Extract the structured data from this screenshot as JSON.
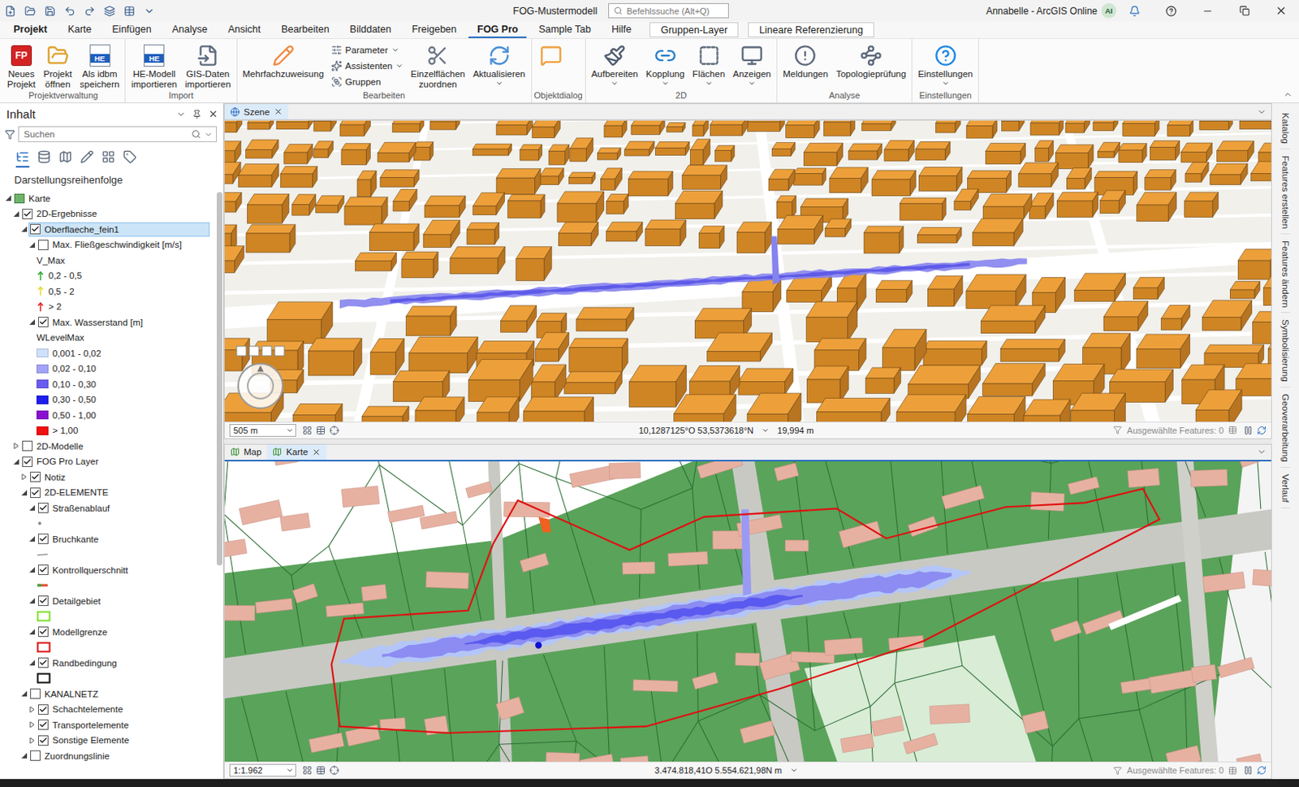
{
  "window": {
    "title": "FOG-Mustermodell",
    "search_placeholder": "Befehlssuche (Alt+Q)",
    "user": "Annabelle - ArcGIS Online",
    "avatar": "AI"
  },
  "ribbon_tabs": [
    {
      "label": "Projekt",
      "kind": "file",
      "selected": false
    },
    {
      "label": "Karte",
      "kind": "tab",
      "selected": false
    },
    {
      "label": "Einfügen",
      "kind": "tab",
      "selected": false
    },
    {
      "label": "Analyse",
      "kind": "tab",
      "selected": false
    },
    {
      "label": "Ansicht",
      "kind": "tab",
      "selected": false
    },
    {
      "label": "Bearbeiten",
      "kind": "tab",
      "selected": false
    },
    {
      "label": "Bilddaten",
      "kind": "tab",
      "selected": false
    },
    {
      "label": "Freigeben",
      "kind": "tab",
      "selected": false
    },
    {
      "label": "FOG Pro",
      "kind": "tab",
      "selected": true
    },
    {
      "label": "Sample Tab",
      "kind": "tab",
      "selected": false
    },
    {
      "label": "Hilfe",
      "kind": "tab",
      "selected": false
    },
    {
      "label": "Gruppen-Layer",
      "kind": "context",
      "selected": false
    },
    {
      "label": "Lineare Referenzierung",
      "kind": "context",
      "selected": false
    }
  ],
  "ribbon_groups": [
    {
      "title": "Projektverwaltung",
      "items": [
        {
          "kind": "large",
          "lines": [
            "Neues",
            "Projekt"
          ],
          "badge": "FP",
          "dropdown": false
        },
        {
          "kind": "large",
          "lines": [
            "Projekt",
            "öffnen"
          ],
          "dropdown": false
        },
        {
          "kind": "large",
          "lines": [
            "Als idbm",
            "speichern"
          ],
          "badge": "HE",
          "dropdown": false
        }
      ]
    },
    {
      "title": "Import",
      "items": [
        {
          "kind": "large",
          "lines": [
            "HE-Modell",
            "importieren"
          ],
          "badge": "HE",
          "dropdown": false
        },
        {
          "kind": "large",
          "lines": [
            "GIS-Daten",
            "importieren"
          ],
          "dropdown": false
        }
      ]
    },
    {
      "title": "Bearbeiten",
      "items": [
        {
          "kind": "large",
          "lines": [
            "Mehrfachzuweisung"
          ],
          "dropdown": false
        },
        {
          "kind": "stack",
          "buttons": [
            {
              "label": "Parameter",
              "dropdown": true
            },
            {
              "label": "Assistenten",
              "dropdown": true
            },
            {
              "label": "Gruppen",
              "dropdown": false
            }
          ]
        },
        {
          "kind": "large",
          "lines": [
            "Einzelflächen",
            "zuordnen"
          ],
          "dropdown": false
        },
        {
          "kind": "large",
          "lines": [
            "Aktualisieren"
          ],
          "dropdown": true
        }
      ]
    },
    {
      "title": "Objektdialog",
      "items": [
        {
          "kind": "large",
          "lines": [],
          "dropdown": false
        }
      ]
    },
    {
      "title": "2D",
      "items": [
        {
          "kind": "large",
          "lines": [
            "Aufbereiten"
          ],
          "dropdown": true
        },
        {
          "kind": "large",
          "lines": [
            "Kopplung"
          ],
          "dropdown": true
        },
        {
          "kind": "large",
          "lines": [
            "Flächen"
          ],
          "dropdown": true
        },
        {
          "kind": "large",
          "lines": [
            "Anzeigen"
          ],
          "dropdown": true
        }
      ]
    },
    {
      "title": "Analyse",
      "items": [
        {
          "kind": "large",
          "lines": [
            "Meldungen"
          ],
          "dropdown": false
        },
        {
          "kind": "large",
          "lines": [
            "Topologieprüfung"
          ],
          "dropdown": false
        }
      ]
    },
    {
      "title": "Einstellungen",
      "items": [
        {
          "kind": "large",
          "lines": [
            "Einstellungen"
          ],
          "dropdown": true
        }
      ]
    }
  ],
  "contents_panel": {
    "title": "Inhalt",
    "search_placeholder": "Suchen",
    "heading": "Darstellungsreihenfolge",
    "tree": [
      {
        "kind": "map",
        "label": "Karte",
        "depth": 0,
        "expanded": true,
        "selected": false
      },
      {
        "kind": "layer",
        "label": "2D-Ergebnisse",
        "depth": 1,
        "expanded": true,
        "checked": true,
        "selected": false
      },
      {
        "kind": "layer",
        "label": "Oberflaeche_fein1",
        "depth": 2,
        "expanded": true,
        "checked": true,
        "selected": true
      },
      {
        "kind": "layer",
        "label": "Max. Fließgeschwindigkeit [m/s]",
        "depth": 3,
        "expanded": true,
        "checked": false,
        "selected": false
      },
      {
        "kind": "label",
        "label": "V_Max",
        "depth": 4,
        "selected": false
      },
      {
        "kind": "arrow",
        "label": "0,2 - 0,5",
        "depth": 4,
        "color": "#2fa82f",
        "selected": false
      },
      {
        "kind": "arrow",
        "label": "0,5 - 2",
        "depth": 4,
        "color": "#e6d830",
        "selected": false
      },
      {
        "kind": "arrow",
        "label": "> 2",
        "depth": 4,
        "color": "#e02020",
        "selected": false
      },
      {
        "kind": "layer",
        "label": "Max. Wasserstand [m]",
        "depth": 3,
        "expanded": true,
        "checked": true,
        "selected": false
      },
      {
        "kind": "label",
        "label": "WLevelMax",
        "depth": 4,
        "selected": false
      },
      {
        "kind": "fill",
        "label": "0,001 - 0,02",
        "depth": 4,
        "color": "#cfe0fb",
        "selected": false
      },
      {
        "kind": "fill",
        "label": "0,02 - 0,10",
        "depth": 4,
        "color": "#a3a3f7",
        "selected": false
      },
      {
        "kind": "fill",
        "label": "0,10 - 0,30",
        "depth": 4,
        "color": "#6a5cf0",
        "selected": false
      },
      {
        "kind": "fill",
        "label": "0,30 - 0,50",
        "depth": 4,
        "color": "#1e1ef0",
        "selected": false
      },
      {
        "kind": "fill",
        "label": "0,50 - 1,00",
        "depth": 4,
        "color": "#8a0fcf",
        "selected": false
      },
      {
        "kind": "fill",
        "label": "> 1,00",
        "depth": 4,
        "color": "#f01010",
        "selected": false
      },
      {
        "kind": "layer",
        "label": "2D-Modelle",
        "depth": 1,
        "expanded": false,
        "checked": false,
        "selected": false
      },
      {
        "kind": "layer",
        "label": "FOG Pro Layer",
        "depth": 1,
        "expanded": true,
        "checked": true,
        "selected": false
      },
      {
        "kind": "layer",
        "label": "Notiz",
        "depth": 2,
        "expanded": false,
        "checked": true,
        "selected": false
      },
      {
        "kind": "layer",
        "label": "2D-ELEMENTE",
        "depth": 2,
        "expanded": true,
        "checked": true,
        "selected": false
      },
      {
        "kind": "layer",
        "label": "Straßenablauf",
        "depth": 3,
        "expanded": true,
        "checked": true,
        "selected": false
      },
      {
        "kind": "point",
        "depth": 4,
        "color": "#8a8a8a",
        "selected": false
      },
      {
        "kind": "layer",
        "label": "Bruchkante",
        "depth": 3,
        "expanded": true,
        "checked": true,
        "selected": false
      },
      {
        "kind": "line",
        "depth": 4,
        "color": "#9a9a9a",
        "selected": false
      },
      {
        "kind": "layer",
        "label": "Kontrollquerschnitt",
        "depth": 3,
        "expanded": true,
        "checked": true,
        "selected": false
      },
      {
        "kind": "section",
        "depth": 4,
        "color": "#e04a2a",
        "selected": false
      },
      {
        "kind": "layer",
        "label": "Detailgebiet",
        "depth": 3,
        "expanded": true,
        "checked": true,
        "selected": false
      },
      {
        "kind": "box",
        "depth": 4,
        "color": "#7ee02a",
        "selected": false
      },
      {
        "kind": "layer",
        "label": "Modellgrenze",
        "depth": 3,
        "expanded": true,
        "checked": true,
        "selected": false
      },
      {
        "kind": "box",
        "depth": 4,
        "color": "#e01010",
        "selected": false
      },
      {
        "kind": "layer",
        "label": "Randbedingung",
        "depth": 3,
        "expanded": true,
        "checked": true,
        "selected": false
      },
      {
        "kind": "box",
        "depth": 4,
        "color": "#111111",
        "selected": false
      },
      {
        "kind": "layer",
        "label": "KANALNETZ",
        "depth": 2,
        "expanded": true,
        "checked": false,
        "selected": false
      },
      {
        "kind": "layer",
        "label": "Schachtelemente",
        "depth": 3,
        "expanded": false,
        "checked": true,
        "selected": false
      },
      {
        "kind": "layer",
        "label": "Transportelemente",
        "depth": 3,
        "expanded": false,
        "checked": true,
        "selected": false
      },
      {
        "kind": "layer",
        "label": "Sonstige Elemente",
        "depth": 3,
        "expanded": false,
        "checked": true,
        "selected": false
      },
      {
        "kind": "layer",
        "label": "Zuordnungslinie",
        "depth": 2,
        "expanded": true,
        "checked": false,
        "selected": false
      }
    ]
  },
  "scene_view": {
    "tab": "Szene",
    "scale": "505 m",
    "coords": "10,1287125°O 53,5373618°N",
    "elevation": "19,994 m",
    "selected_features": "Ausgewählte Features: 0"
  },
  "map_view": {
    "tabs": [
      {
        "label": "Map",
        "selected": false,
        "closable": false
      },
      {
        "label": "Karte",
        "selected": true,
        "closable": true
      }
    ],
    "scale": "1:1.962",
    "coords": "3.474.818,41O 5.554.621,98N m",
    "selected_features": "Ausgewählte Features: 0"
  },
  "side_tabs": [
    "Katalog",
    "Features erstellen",
    "Features ändern",
    "Symbolisierung",
    "Geoverarbeitung",
    "Verlauf"
  ]
}
